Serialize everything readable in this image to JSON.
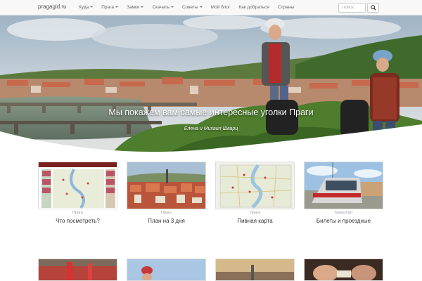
{
  "nav": {
    "brand": "pragagid.ru",
    "items": [
      {
        "label": "Куда",
        "dropdown": true
      },
      {
        "label": "Прага",
        "dropdown": true
      },
      {
        "label": "Замки",
        "dropdown": true
      },
      {
        "label": "Скачать",
        "dropdown": true
      },
      {
        "label": "Советы",
        "dropdown": true
      },
      {
        "label": "Мой блог",
        "dropdown": false
      },
      {
        "label": "Как добраться",
        "dropdown": false
      },
      {
        "label": "Страны",
        "dropdown": false
      }
    ],
    "search_placeholder": "Поиск"
  },
  "hero": {
    "title": "Мы покажем вам самые интересные уголки Праги",
    "subtitle": "Елена и Михаил Шварц"
  },
  "cards": [
    {
      "category": "Прага",
      "title": "Что посмотреть?",
      "thumb": "map-guide"
    },
    {
      "category": "Прага",
      "title": "План на 3 дня",
      "thumb": "city-roofs"
    },
    {
      "category": "Прага",
      "title": "Пивная карта",
      "thumb": "map"
    },
    {
      "category": "Транспорт",
      "title": "Билеты и проездные",
      "thumb": "tram"
    }
  ],
  "colors": {
    "navbar": "#f8f8f8",
    "text": "#333333",
    "muted": "#999999"
  }
}
